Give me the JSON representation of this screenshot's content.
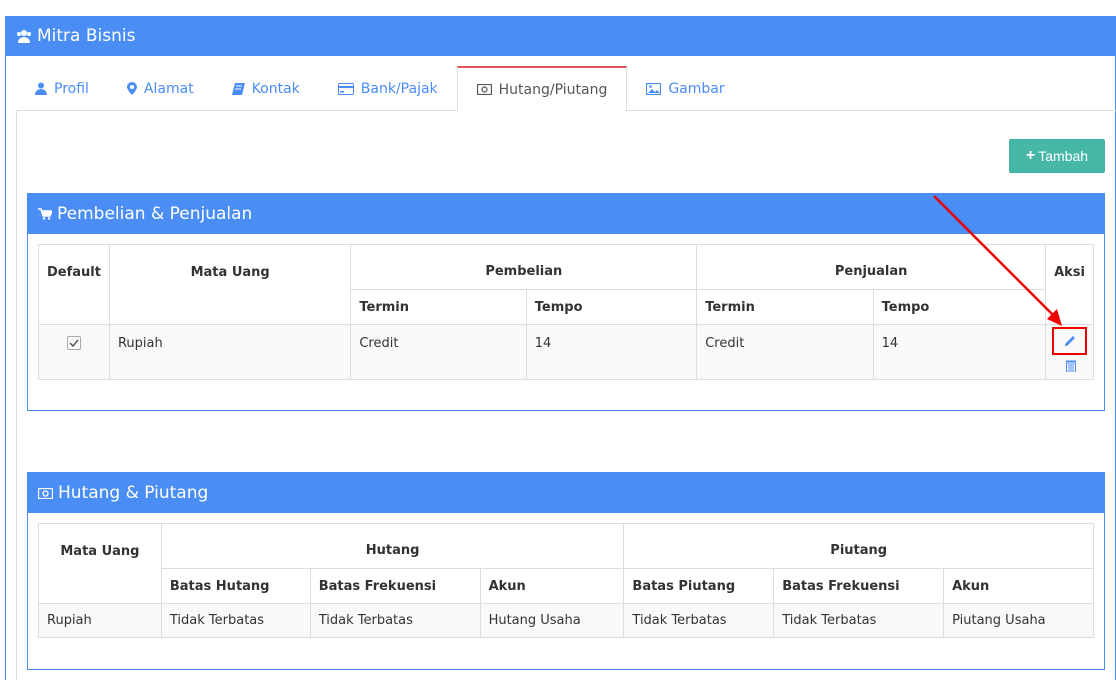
{
  "panel": {
    "title": "Mitra Bisnis",
    "icon": "users-icon"
  },
  "tabs": [
    {
      "label": "Profil",
      "icon": "user-icon",
      "active": false
    },
    {
      "label": "Alamat",
      "icon": "map-marker-icon",
      "active": false
    },
    {
      "label": "Kontak",
      "icon": "book-icon",
      "active": false
    },
    {
      "label": "Bank/Pajak",
      "icon": "credit-card-icon",
      "active": false
    },
    {
      "label": "Hutang/Piutang",
      "icon": "money-icon",
      "active": true
    },
    {
      "label": "Gambar",
      "icon": "image-icon",
      "active": false
    }
  ],
  "toolbar": {
    "add_label": "Tambah"
  },
  "pembelian_penjualan": {
    "title": "Pembelian & Penjualan",
    "headers": {
      "default": "Default",
      "mata_uang": "Mata Uang",
      "pembelian": "Pembelian",
      "penjualan": "Penjualan",
      "aksi": "Aksi",
      "termin": "Termin",
      "tempo": "Tempo"
    },
    "rows": [
      {
        "default_checked": true,
        "mata_uang": "Rupiah",
        "pembelian_termin": "Credit",
        "pembelian_tempo": "14",
        "penjualan_termin": "Credit",
        "penjualan_tempo": "14"
      }
    ]
  },
  "hutang_piutang": {
    "title": "Hutang & Piutang",
    "headers": {
      "mata_uang": "Mata Uang",
      "hutang": "Hutang",
      "piutang": "Piutang",
      "batas_hutang": "Batas Hutang",
      "batas_frekuensi": "Batas Frekuensi",
      "akun": "Akun",
      "batas_piutang": "Batas Piutang"
    },
    "rows": [
      {
        "mata_uang": "Rupiah",
        "batas_hutang": "Tidak Terbatas",
        "hutang_batas_frekuensi": "Tidak Terbatas",
        "hutang_akun": "Hutang Usaha",
        "batas_piutang": "Tidak Terbatas",
        "piutang_batas_frekuensi": "Tidak Terbatas",
        "piutang_akun": "Piutang Usaha"
      }
    ]
  },
  "colors": {
    "primary": "#4a8ef5",
    "success": "#47b8a8",
    "active_tab_border": "#e0555e",
    "highlight": "#ee0000"
  }
}
